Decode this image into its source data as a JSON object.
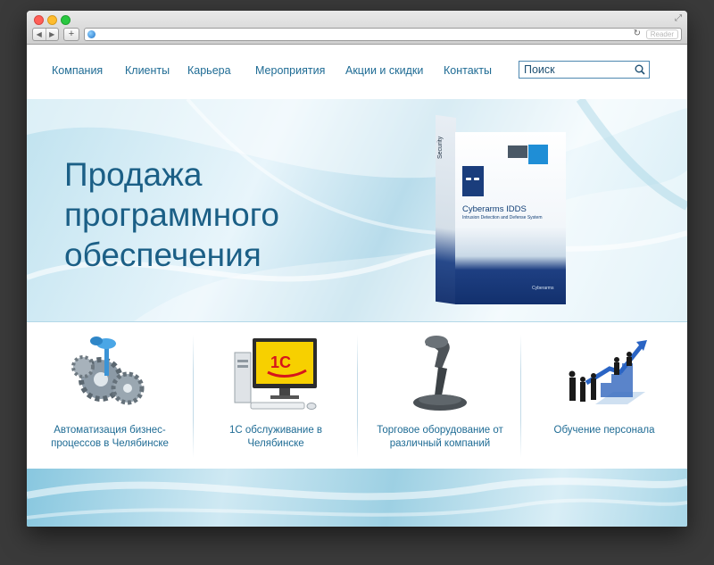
{
  "browser": {
    "reader_label": "Reader"
  },
  "nav": {
    "items": [
      {
        "label": "Компания"
      },
      {
        "label": "Клиенты"
      },
      {
        "label": "Карьера"
      },
      {
        "label": "Мероприятия"
      },
      {
        "label": "Акции и скидки"
      },
      {
        "label": "Контакты"
      }
    ],
    "search_placeholder": "Поиск"
  },
  "hero": {
    "title_lines": [
      "Продажа",
      "программного",
      "обеспечения"
    ],
    "product": {
      "name": "Cyberarms IDDS",
      "subtitle": "Intrusion Detection and Defense System",
      "brand": "Cyberarms",
      "side_word": "Security"
    }
  },
  "features": [
    {
      "icon": "gears-key-icon",
      "label": "Автоматизация бизнес-процессов в Челябинске"
    },
    {
      "icon": "computer-1c-icon",
      "label": "1С обслуживание в Челябинске"
    },
    {
      "icon": "barcode-scanner-icon",
      "label": "Торговое оборудование от различный компаний"
    },
    {
      "icon": "team-growth-icon",
      "label": "Обучение персонала"
    }
  ],
  "colors": {
    "link": "#1e6b94",
    "hero_title": "#1b5f86",
    "accent_blue": "#1a3d7c",
    "onec_yellow": "#f7d000",
    "onec_red": "#d6141c"
  }
}
